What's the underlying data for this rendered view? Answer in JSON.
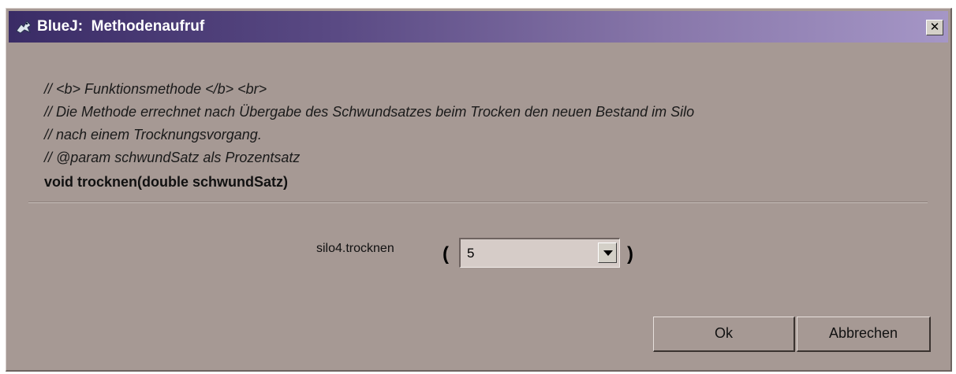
{
  "window": {
    "title": "BlueJ:  Methodenaufruf",
    "close_glyph": "✕"
  },
  "doc_comment": {
    "lines": [
      "// <b> Funktionsmethode </b> <br>",
      "// Die Methode errechnet nach Übergabe des Schwundsatzes beim Trocken den neuen Bestand im Silo",
      "// nach einem Trocknungsvorgang.",
      "// @param schwundSatz als Prozentsatz"
    ],
    "signature": "void trocknen(double schwundSatz)"
  },
  "call": {
    "label": "silo4.trocknen",
    "open_paren": "(",
    "close_paren": ")",
    "argument_value": "5"
  },
  "buttons": {
    "ok": "Ok",
    "cancel": "Abbrechen"
  },
  "icons": {
    "app": "bluej-bird-icon",
    "close": "close-icon",
    "dropdown": "chevron-down-icon"
  }
}
